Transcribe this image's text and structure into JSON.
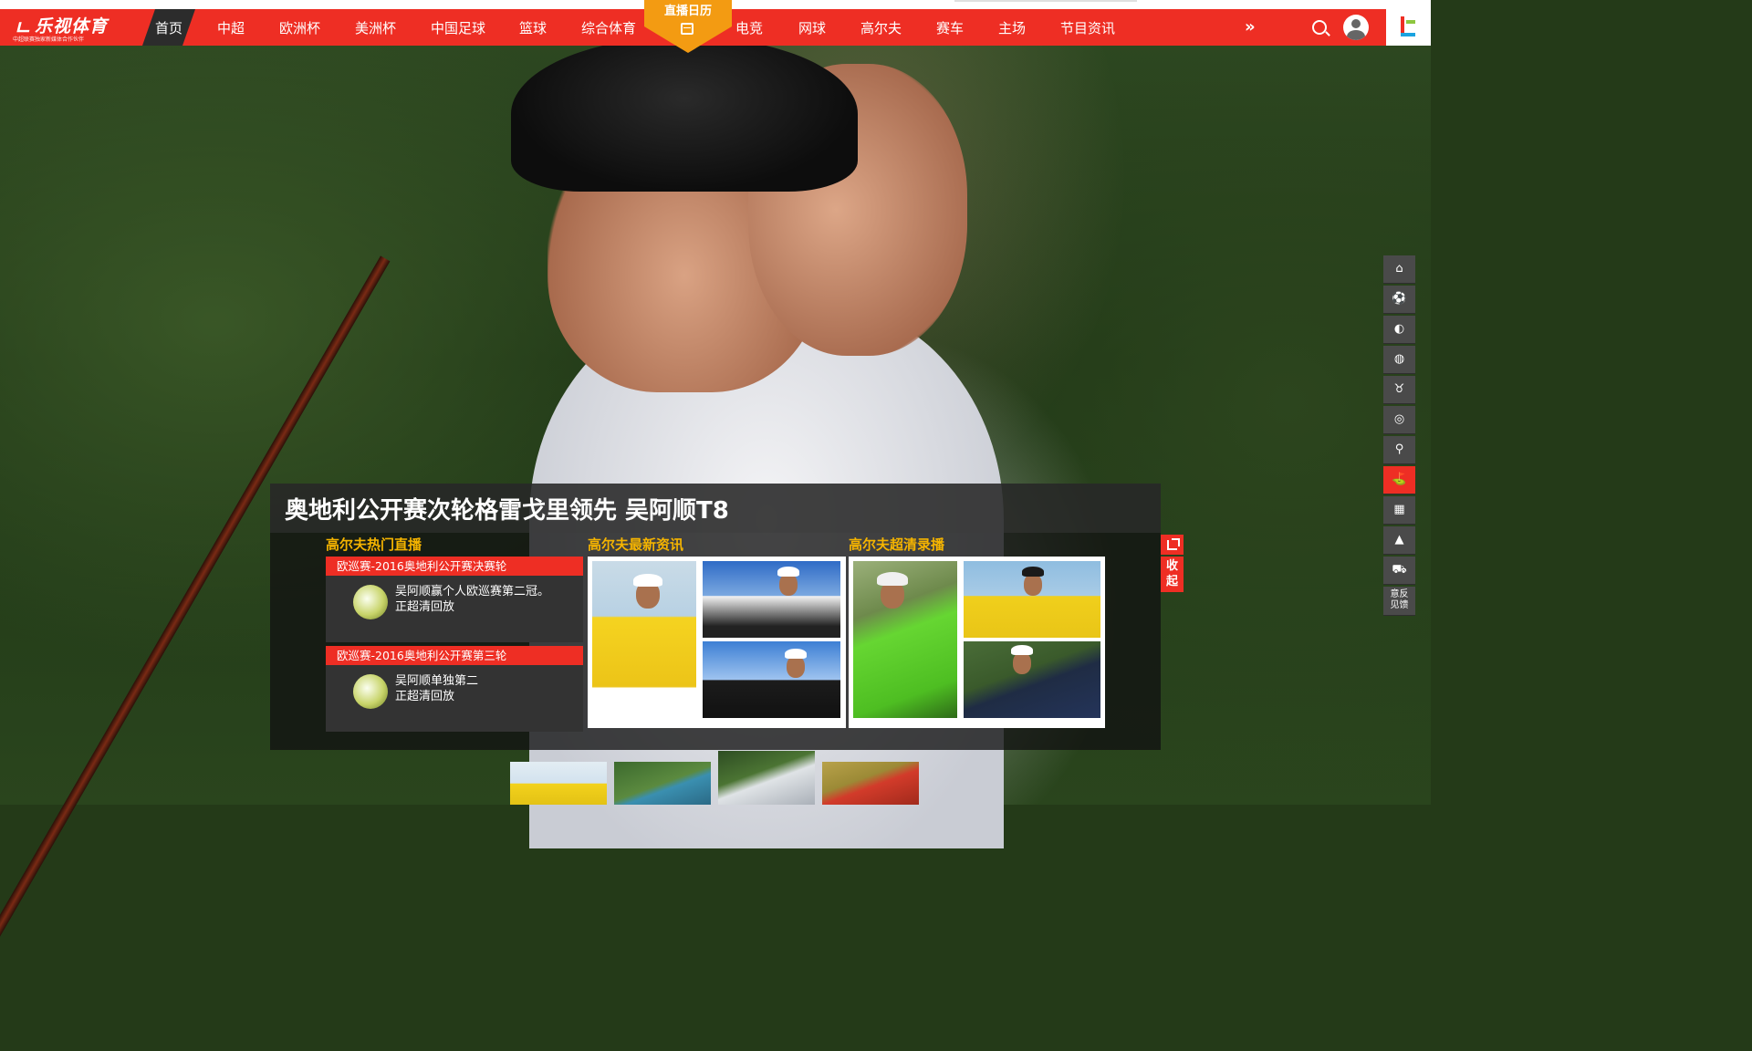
{
  "brand": {
    "name": "乐视体育",
    "tagline": "中超联赛独家新媒体合作伙伴"
  },
  "nav": {
    "home": "首页",
    "items": [
      "中超",
      "欧洲杯",
      "美洲杯",
      "中国足球",
      "篮球",
      "综合体育",
      "电竞",
      "网球",
      "高尔夫",
      "赛车",
      "主场",
      "节目资讯"
    ],
    "calendar": "直播日历",
    "more": "»",
    "accent_color": "#ee2e24",
    "calendar_color": "#f39b12"
  },
  "headline": "奥地利公开赛次轮格雷戈里领先 吴阿顺T8",
  "sections": {
    "live_title": "高尔夫热门直播",
    "news_title": "高尔夫最新资讯",
    "replay_title": "高尔夫超清录播"
  },
  "live": [
    {
      "title": "欧巡赛-2016奥地利公开赛决赛轮",
      "line1": "吴阿顺赢个人欧巡赛第二冠。",
      "line2": "正超清回放"
    },
    {
      "title": "欧巡赛-2016奥地利公开赛第三轮",
      "line1": "吴阿顺单独第二",
      "line2": "正超清回放"
    }
  ],
  "side_panel": {
    "collapse": "收起"
  },
  "sidebar": {
    "icons": [
      "home-icon",
      "soccer-ball-icon",
      "euro-cup-icon",
      "basketball-icon",
      "medal-icon",
      "game-controller-icon",
      "tennis-icon",
      "golf-icon",
      "racing-flag-icon",
      "home-court-icon",
      "shopping-cart-icon"
    ],
    "feedback": "意反见馈"
  }
}
